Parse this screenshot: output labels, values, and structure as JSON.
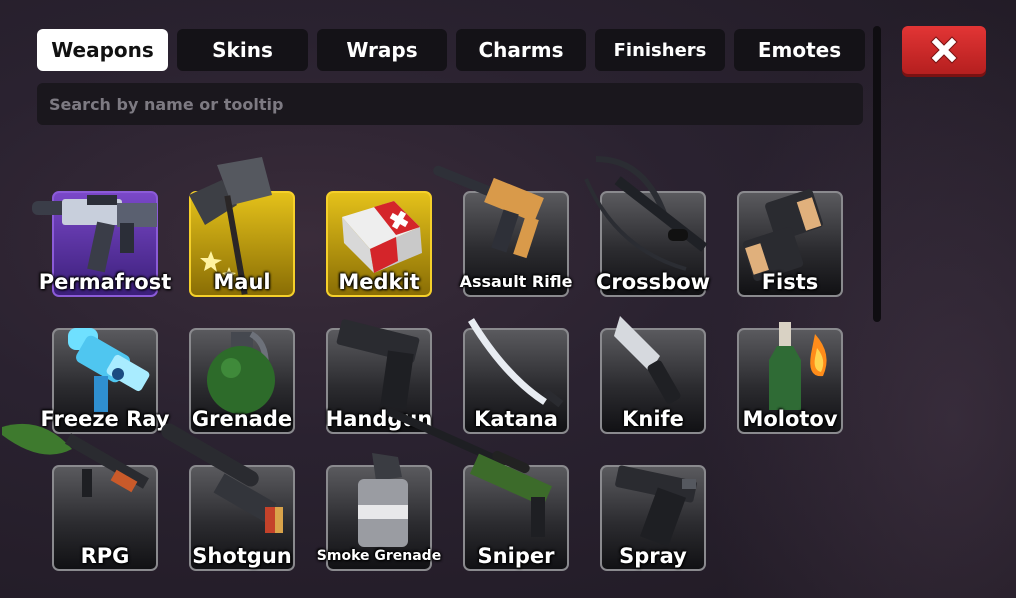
{
  "tabs": [
    {
      "label": "Weapons",
      "active": true
    },
    {
      "label": "Skins",
      "active": false
    },
    {
      "label": "Wraps",
      "active": false
    },
    {
      "label": "Charms",
      "active": false
    },
    {
      "label": "Finishers",
      "active": false
    },
    {
      "label": "Emotes",
      "active": false
    }
  ],
  "search": {
    "placeholder": "Search by name or tooltip"
  },
  "close_button": {
    "icon": "close-x-icon",
    "color": "#d32a2a"
  },
  "items": [
    {
      "name": "Permafrost",
      "rarity": "purple",
      "icon": "permafrost-gun-icon"
    },
    {
      "name": "Maul",
      "rarity": "gold",
      "icon": "maul-hammer-icon"
    },
    {
      "name": "Medkit",
      "rarity": "gold",
      "icon": "medkit-icon"
    },
    {
      "name": "Assault Rifle",
      "rarity": "default",
      "icon": "assault-rifle-icon"
    },
    {
      "name": "Crossbow",
      "rarity": "default",
      "icon": "crossbow-icon"
    },
    {
      "name": "Fists",
      "rarity": "default",
      "icon": "fists-icon"
    },
    {
      "name": "Freeze Ray",
      "rarity": "default",
      "icon": "freeze-ray-icon"
    },
    {
      "name": "Grenade",
      "rarity": "default",
      "icon": "grenade-icon"
    },
    {
      "name": "Handgun",
      "rarity": "default",
      "icon": "handgun-icon"
    },
    {
      "name": "Katana",
      "rarity": "default",
      "icon": "katana-icon"
    },
    {
      "name": "Knife",
      "rarity": "default",
      "icon": "knife-icon"
    },
    {
      "name": "Molotov",
      "rarity": "default",
      "icon": "molotov-icon"
    },
    {
      "name": "RPG",
      "rarity": "default",
      "icon": "rpg-icon"
    },
    {
      "name": "Shotgun",
      "rarity": "default",
      "icon": "shotgun-icon"
    },
    {
      "name": "Smoke Grenade",
      "rarity": "default",
      "icon": "smoke-grenade-icon"
    },
    {
      "name": "Sniper",
      "rarity": "default",
      "icon": "sniper-icon"
    },
    {
      "name": "Spray",
      "rarity": "default",
      "icon": "spray-can-icon"
    }
  ],
  "colors": {
    "active_tab": "#ffffff",
    "inactive_tab": "#141217",
    "gold": "#e4c11a",
    "purple": "#7a48c8",
    "close": "#d32a2a"
  }
}
